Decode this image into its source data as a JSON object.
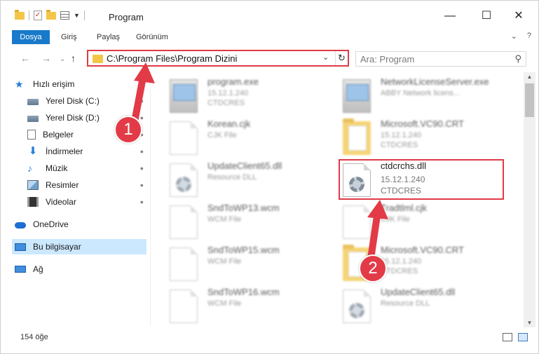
{
  "window": {
    "title": "Program",
    "minimize": "—",
    "maximize": "☐",
    "close": "✕"
  },
  "ribbon": {
    "tabs": [
      "Dosya",
      "Giriş",
      "Paylaş",
      "Görünüm"
    ],
    "expand": "⌄",
    "help": "?"
  },
  "address": {
    "path": "C:\\Program Files\\Program Dizini",
    "chevron": "⌄",
    "refresh": "↻"
  },
  "nav": {
    "back": "←",
    "forward": "→",
    "recent": "⌄",
    "up": "↑"
  },
  "search": {
    "placeholder": "Ara: Program",
    "icon": "⚲"
  },
  "sidebar": {
    "items": [
      {
        "label": "Hızlı erişim",
        "icon": "star-icon",
        "pinned": false
      },
      {
        "label": "Yerel Disk (C:)",
        "icon": "drive-icon",
        "pinned": true
      },
      {
        "label": "Yerel Disk (D:)",
        "icon": "drive-icon",
        "pinned": true
      },
      {
        "label": "Belgeler",
        "icon": "document-icon",
        "pinned": true
      },
      {
        "label": "İndirmeler",
        "icon": "download-icon",
        "pinned": true
      },
      {
        "label": "Müzik",
        "icon": "music-icon",
        "pinned": true
      },
      {
        "label": "Resimler",
        "icon": "pictures-icon",
        "pinned": true
      },
      {
        "label": "Videolar",
        "icon": "videos-icon",
        "pinned": true
      },
      {
        "label": "OneDrive",
        "icon": "onedrive-icon",
        "pinned": false
      },
      {
        "label": "Bu bilgisayar",
        "icon": "computer-icon",
        "pinned": false
      },
      {
        "label": "Ağ",
        "icon": "network-icon",
        "pinned": false
      }
    ],
    "pin_glyph": "📌"
  },
  "files": [
    {
      "name": "program.exe",
      "line1": "15.12.1.240",
      "line2": "CTDCRES",
      "type": "exe"
    },
    {
      "name": "NetworkLicenseServer.exe",
      "line1": "ABBY Network licens...",
      "line2": "",
      "type": "exe"
    },
    {
      "name": "Korean.cjk",
      "line1": "CJK File",
      "line2": "",
      "type": "doc"
    },
    {
      "name": "Microsoft.VC90.CRT",
      "line1": "15.12.1.240",
      "line2": "CTDCRES",
      "type": "folder"
    },
    {
      "name": "UpdateClient65.dll",
      "line1": "Resource DLL",
      "line2": "",
      "type": "dll"
    },
    {
      "name": "ctdcrchs.dll",
      "line1": "15.12.1.240",
      "line2": "CTDCRES",
      "type": "dll"
    },
    {
      "name": "SndToWP13.wcm",
      "line1": "WCM File",
      "line2": "",
      "type": "doc"
    },
    {
      "name": "Tradtlml.cjk",
      "line1": "CJK File",
      "line2": "",
      "type": "doc"
    },
    {
      "name": "SndToWP15.wcm",
      "line1": "WCM File",
      "line2": "",
      "type": "doc"
    },
    {
      "name": "Microsoft.VC90.CRT",
      "line1": "15.12.1.240",
      "line2": "CTDCRES",
      "type": "folder"
    },
    {
      "name": "SndToWP16.wcm",
      "line1": "WCM File",
      "line2": "",
      "type": "doc"
    },
    {
      "name": "UpdateClient65.dll",
      "line1": "Resource DLL",
      "line2": "",
      "type": "dll"
    }
  ],
  "annotations": {
    "badge1": "1",
    "badge2": "2",
    "accent": "#e23b47"
  },
  "status": {
    "count": "154 öğe"
  },
  "scroll": {
    "up": "▲",
    "down": "▼"
  },
  "colors": {
    "selection": "#cce8ff",
    "file_tab": "#1979ca"
  }
}
